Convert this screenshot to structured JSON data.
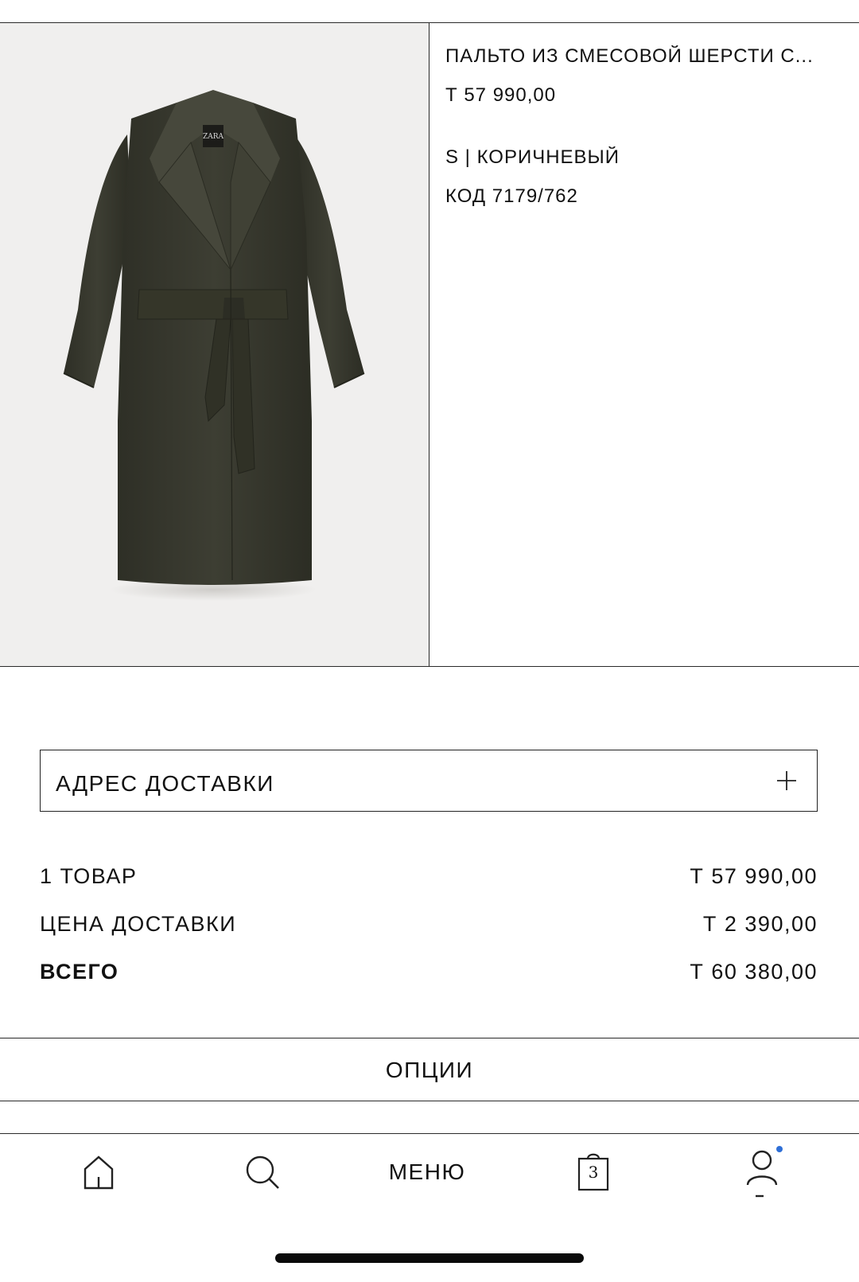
{
  "product": {
    "title": "ПАЛЬТО ИЗ СМЕСОВОЙ ШЕРСТИ С...",
    "price": "Т 57 990,00",
    "variant": "S | КОРИЧНЕВЫЙ",
    "code": "КОД 7179/762",
    "image": {
      "label_text": "ZARA",
      "icon": "coat-image"
    }
  },
  "delivery": {
    "label": "АДРЕС ДОСТАВКИ",
    "icon": "plus-icon"
  },
  "summary": {
    "items_label": "1 ТОВАР",
    "items_value": "Т 57 990,00",
    "shipping_label": "ЦЕНА ДОСТАВКИ",
    "shipping_value": "Т 2 390,00",
    "total_label": "ВСЕГО",
    "total_value": "Т 60 380,00"
  },
  "options": {
    "label": "ОПЦИИ"
  },
  "nav": {
    "home_icon": "home-icon",
    "search_icon": "search-icon",
    "menu_label": "МЕНЮ",
    "cart_icon": "bag-icon",
    "cart_count": "3",
    "profile_icon": "user-icon"
  },
  "colors": {
    "image_background": "#f0efee",
    "coat": "#3a3b30",
    "notification_dot": "#2f6fd6",
    "text": "#111111"
  }
}
